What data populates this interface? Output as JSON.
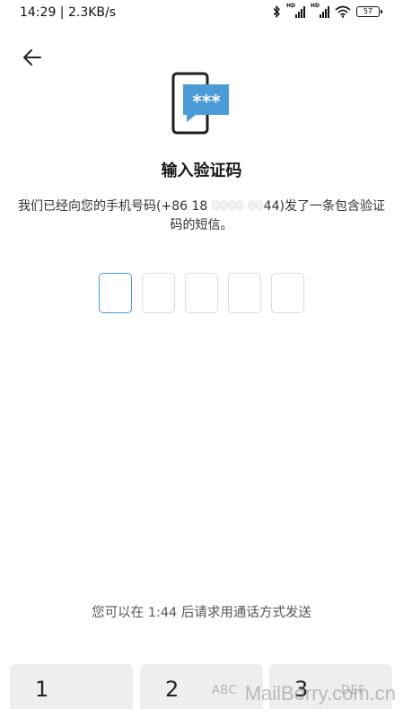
{
  "status_bar": {
    "time_speed": "14:29 | 2.3KB/s",
    "sim1_label": "HD",
    "sim2_label": "HD",
    "battery": "57"
  },
  "header": {
    "back_icon": "arrow-left-icon"
  },
  "illustration": {
    "icon": "phone-message-icon",
    "bubble_text": "***",
    "accent_color": "#4a9bd6"
  },
  "title": "输入验证码",
  "instruction": {
    "part1": "我们已经向您的手机号码(+86 18",
    "masked": "  0000 00",
    "part2": "44)发了一条包含验证码的短信。"
  },
  "code_input": {
    "length": 5,
    "active_index": 0,
    "values": [
      "",
      "",
      "",
      "",
      ""
    ]
  },
  "resend_hint": "您可以在 1:44 后请求用通话方式发送",
  "keypad": {
    "keys": [
      {
        "digit": "1",
        "letters": ""
      },
      {
        "digit": "2",
        "letters": "ABC"
      },
      {
        "digit": "3",
        "letters": "DEF"
      }
    ]
  },
  "watermark": "MailBerry.com.cn"
}
